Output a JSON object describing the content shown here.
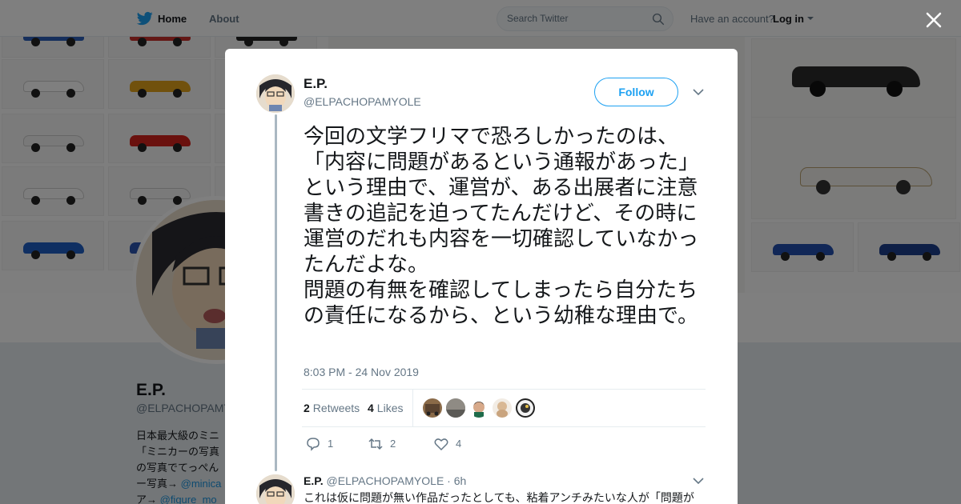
{
  "nav": {
    "home_label": "Home",
    "about_label": "About",
    "search_placeholder": "Search Twitter",
    "have_account": "Have an account?",
    "login_label": "Log in"
  },
  "background_profile": {
    "name": "E.P.",
    "handle": "@ELPACHOPAMY",
    "bio_lines": [
      "日本最大級のミニ",
      "「ミニカーの写真",
      "の写真でてっぺん"
    ],
    "bio_link_line_1": {
      "prefix": "ー写真→ ",
      "link": "@minica"
    },
    "bio_link_line_2": {
      "prefix": "ア→ ",
      "link": "@figure_mo"
    }
  },
  "modal": {
    "author_name": "E.P.",
    "author_handle": "@ELPACHOPAMYOLE",
    "follow_label": "Follow",
    "tweet_paragraphs": [
      "今回の文学フリマで恐ろしかったのは、「内容に問題があるという通報があった」という理由で、運営が、ある出展者に注意書きの追記を迫ってたんだけど、その時に運営のだれも内容を一切確認していなかったんだよな。",
      "問題の有無を確認してしまったら自分たちの責任になるから、という幼稚な理由で。"
    ],
    "timestamp": "8:03 PM - 24 Nov 2019",
    "retweets_count": "2",
    "retweets_label": "Retweets",
    "likes_count": "4",
    "likes_label": "Likes",
    "actions": {
      "reply_count": "1",
      "retweet_count": "2",
      "like_count": "4"
    }
  },
  "reply": {
    "name": "E.P.",
    "handle": "@ELPACHOPAMYOLE",
    "separator": "·",
    "age": "6h",
    "text": "これは仮に問題が無い作品だったとしても、粘着アンチみたいな人が「問題が"
  },
  "colors": {
    "accent": "#1da1f2",
    "text": "#14171a",
    "muted": "#657786",
    "thread_line": "#aab8c2"
  },
  "icons": [
    "twitter-bird-icon",
    "search-icon",
    "caret-down-icon",
    "close-icon",
    "chevron-down-icon",
    "reply-icon",
    "retweet-icon",
    "like-icon"
  ]
}
